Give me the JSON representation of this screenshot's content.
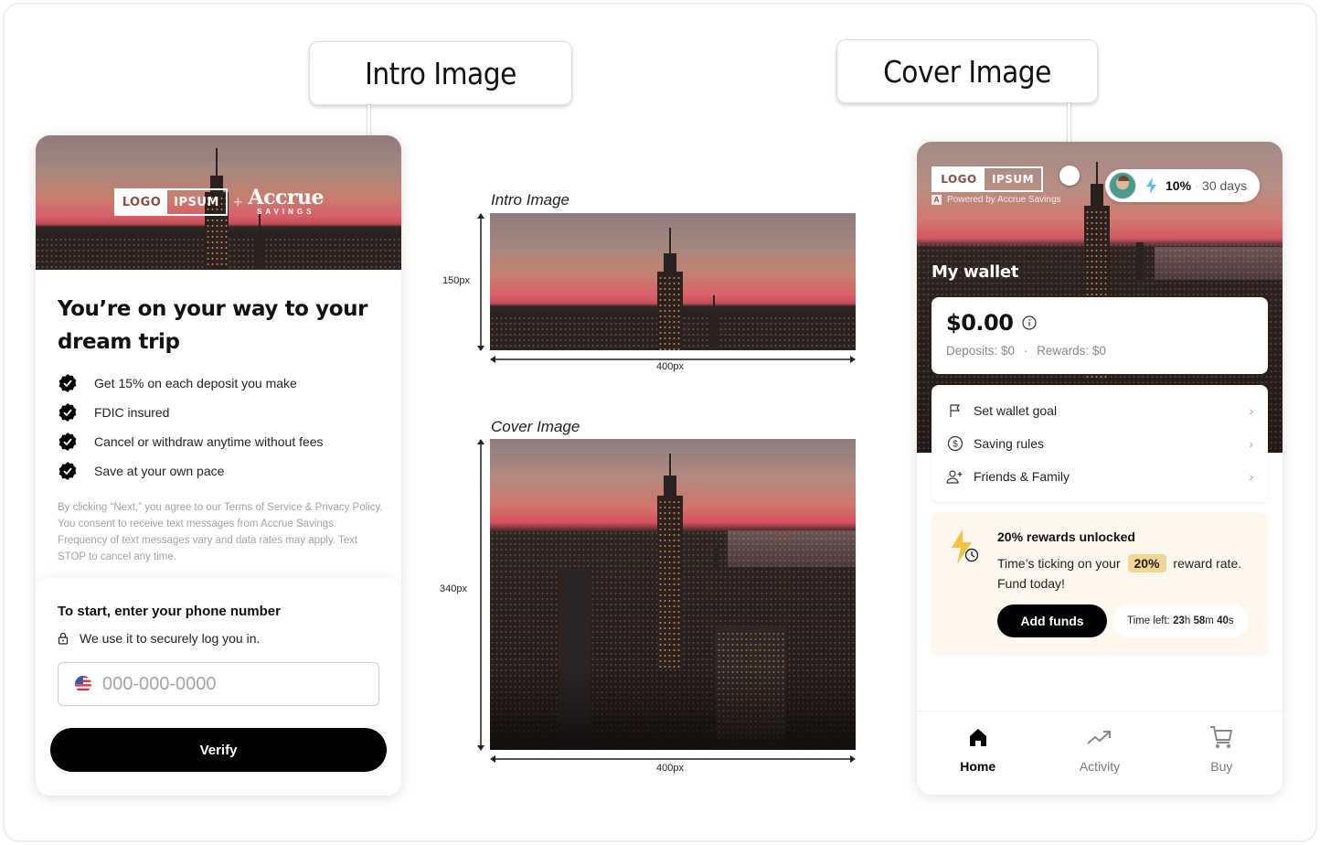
{
  "callouts": {
    "intro": "Intro Image",
    "cover": "Cover Image"
  },
  "intro_screen": {
    "brand": {
      "logo_left": "LOGO",
      "logo_right": "IPSUM",
      "plus": "+",
      "partner_name": "Accrue",
      "partner_sub": "SAVINGS"
    },
    "title": "You’re on your way to your dream trip",
    "benefits": [
      "Get 15% on each deposit you make",
      "FDIC insured",
      "Cancel or withdraw anytime without fees",
      "Save at your own pace"
    ],
    "legal": "By clicking “Next,” you agree to our Terms of Service & Privacy Policy. You consent to receive text messages from Accrue Savings. Frequency of text messages vary and data rates may apply. Text STOP to cancel any time.",
    "phone_prompt": "To start, enter your phone number",
    "phone_note": "We use it to securely log you in.",
    "phone_placeholder": "000-000-0000",
    "phone_value": "",
    "verify_label": "Verify"
  },
  "diagrams": {
    "intro": {
      "label": "Intro Image",
      "height_label": "150px",
      "width_label": "400px"
    },
    "cover": {
      "label": "Cover Image",
      "height_label": "340px",
      "width_label": "400px"
    }
  },
  "wallet_screen": {
    "brand": {
      "logo_left": "LOGO",
      "logo_right": "IPSUM",
      "powered_mark": "A",
      "powered_text": "Powered by Accrue Savings"
    },
    "streak": {
      "rate": "10%",
      "separator": "·",
      "days": "30 days"
    },
    "wallet_title": "My wallet",
    "balance": "$0.00",
    "deposits": "Deposits: $0",
    "dot": "·",
    "rewards": "Rewards: $0",
    "menu": [
      {
        "label": "Set wallet goal",
        "icon": "flag-icon"
      },
      {
        "label": "Saving rules",
        "icon": "dollar-circle-icon"
      },
      {
        "label": "Friends & Family",
        "icon": "add-people-icon"
      }
    ],
    "reward": {
      "title": "20% rewards unlocked",
      "text_before": "Time’s ticking on your",
      "chip": "20%",
      "text_after": "reward rate. Fund today!",
      "button": "Add funds",
      "timer_label": "Time left:",
      "hours": "23",
      "h": "h",
      "minutes": "58",
      "m": "m",
      "seconds": "40",
      "s": "s"
    },
    "tabs": [
      {
        "label": "Home",
        "active": true
      },
      {
        "label": "Activity",
        "active": false
      },
      {
        "label": "Buy",
        "active": false
      }
    ]
  },
  "colors": {
    "brand_logo": "#8b4e45",
    "chip_bg": "#f1d794",
    "reward_card_bg": "#fdf7ee",
    "bolt": "#f7c144",
    "streak_bolt": "#5bc0eb"
  }
}
